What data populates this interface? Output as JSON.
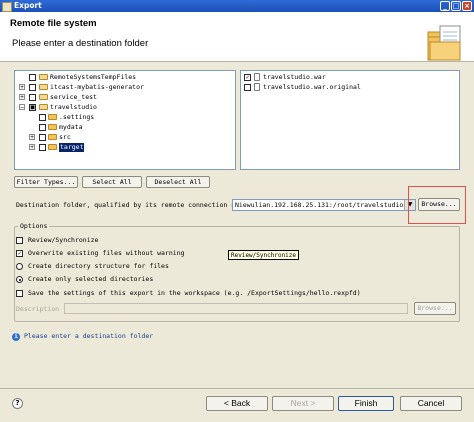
{
  "window": {
    "title": "Export",
    "controls": [
      "_",
      "□",
      "×"
    ]
  },
  "header": {
    "title": "Remote file system",
    "message": "Please enter a destination folder"
  },
  "tree": [
    {
      "label": "RemoteSystemsTempFiles",
      "expander": "",
      "checked": false,
      "icon": "project"
    },
    {
      "label": "itcast-mybatis-generator",
      "expander": "+",
      "checked": false,
      "icon": "project"
    },
    {
      "label": "service_test",
      "expander": "+",
      "checked": false,
      "icon": "project"
    },
    {
      "label": "travelstudio",
      "expander": "−",
      "checked": true,
      "icon": "project"
    },
    {
      "label": ".settings",
      "expander": "",
      "checked": false,
      "icon": "folder"
    },
    {
      "label": "mydata",
      "expander": "",
      "checked": false,
      "icon": "folder"
    },
    {
      "label": "src",
      "expander": "+",
      "checked": false,
      "icon": "folder"
    },
    {
      "label": "target",
      "expander": "+",
      "checked": false,
      "icon": "folder",
      "selected": true
    }
  ],
  "files": [
    {
      "label": "travelstudio.war",
      "checked": true
    },
    {
      "label": "travelstudio.war.original",
      "checked": false
    }
  ],
  "buttons": {
    "filter_types": "Filter Types...",
    "select_all": "Select All",
    "deselect_all": "Deselect All",
    "browse": "Browse...",
    "browse_desc": "Browse..."
  },
  "destination": {
    "label": "Destination folder, qualified by its remote connection name:",
    "value": "Niewulian.192.168.25.131:/root/travelstudio"
  },
  "options": {
    "legend": "Options",
    "review": "Review/Synchronize",
    "overwrite": "Overwrite existing files without warning",
    "create_structure": "Create directory structure for files",
    "create_selected": "Create only selected directories",
    "save_settings": "Save the settings of this export in the workspace (e.g. /ExportSettings/hello.rexpfd)",
    "description_label": "Description file:",
    "tooltip": "Review/Synchronize"
  },
  "status": {
    "message": "Please enter a destination folder"
  },
  "footer": {
    "back": "< Back",
    "next": "Next >",
    "finish": "Finish",
    "cancel": "Cancel",
    "help": "?"
  }
}
